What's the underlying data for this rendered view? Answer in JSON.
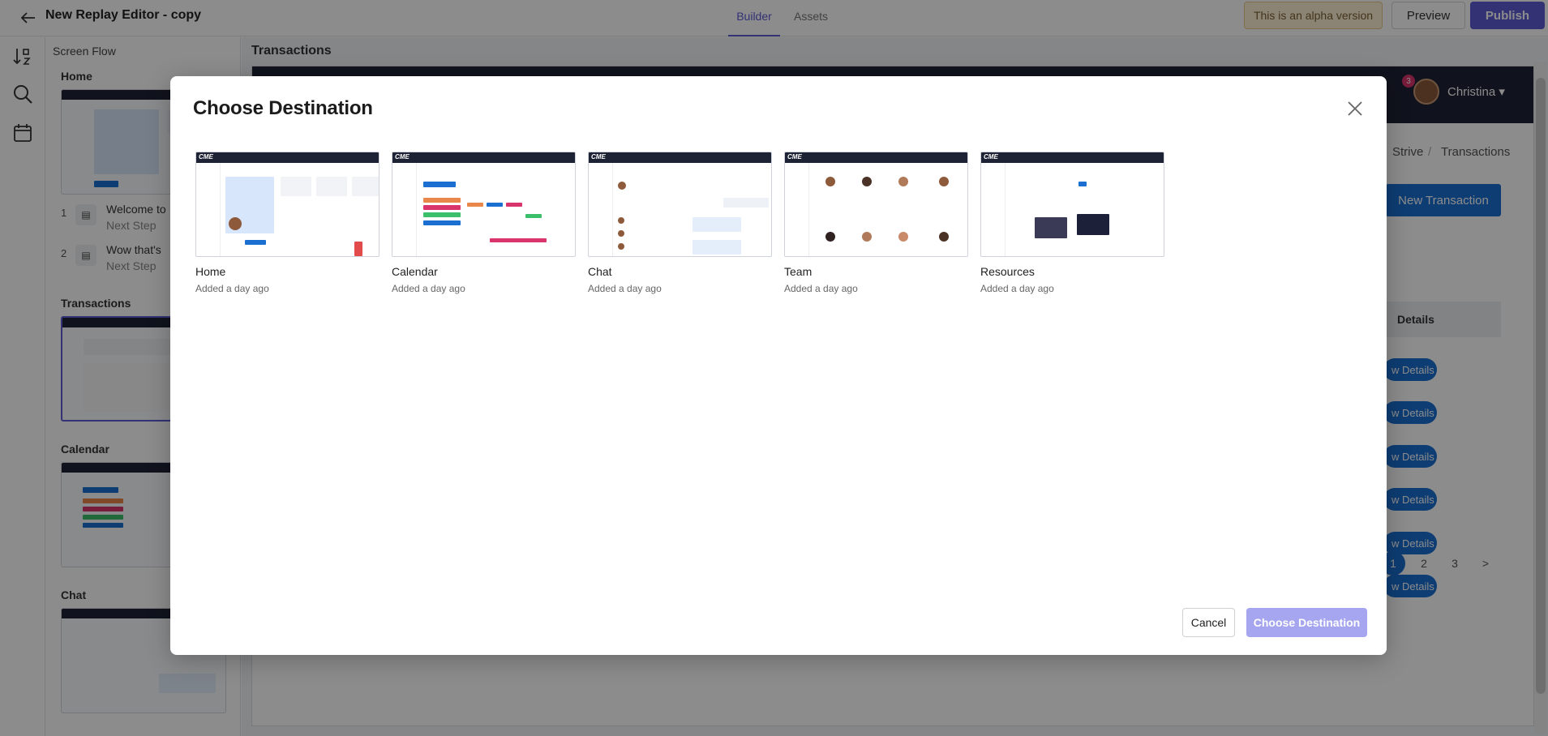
{
  "topbar": {
    "title": "New Replay Editor - copy",
    "tabs": [
      {
        "label": "Builder",
        "active": true
      },
      {
        "label": "Assets",
        "active": false
      }
    ],
    "alpha_notice": "This is an alpha version",
    "preview_label": "Preview",
    "publish_label": "Publish"
  },
  "flow": {
    "title": "Screen Flow",
    "sections": [
      {
        "name": "Home"
      },
      {
        "name": "Transactions"
      },
      {
        "name": "Calendar"
      },
      {
        "name": "Chat"
      }
    ],
    "steps": [
      {
        "num": "1",
        "title": "Welcome to",
        "sub": "Next Step"
      },
      {
        "num": "2",
        "title": "Wow that's",
        "sub": "Next Step"
      }
    ]
  },
  "canvas": {
    "title": "Transactions",
    "app": {
      "user_name": "Christina",
      "notification_count": "3",
      "breadcrumb": [
        "Strive",
        "/",
        "Transactions"
      ],
      "new_transaction_label": "New Transaction",
      "details_header": "Details",
      "details_button": "w Details",
      "pages": [
        "1",
        "2",
        "3",
        ">"
      ]
    }
  },
  "modal": {
    "title": "Choose Destination",
    "destinations": [
      {
        "name": "Home",
        "added": "Added a day ago"
      },
      {
        "name": "Calendar",
        "added": "Added a day ago"
      },
      {
        "name": "Chat",
        "added": "Added a day ago"
      },
      {
        "name": "Team",
        "added": "Added a day ago"
      },
      {
        "name": "Resources",
        "added": "Added a day ago"
      }
    ],
    "thumb_logo": "CME",
    "cancel_label": "Cancel",
    "confirm_label": "Choose Destination"
  },
  "colors": {
    "accent": "#5b5bd6",
    "app_header": "#1e2235",
    "app_primary": "#1a6fd1",
    "confirm_disabled": "#a5a5f0"
  }
}
